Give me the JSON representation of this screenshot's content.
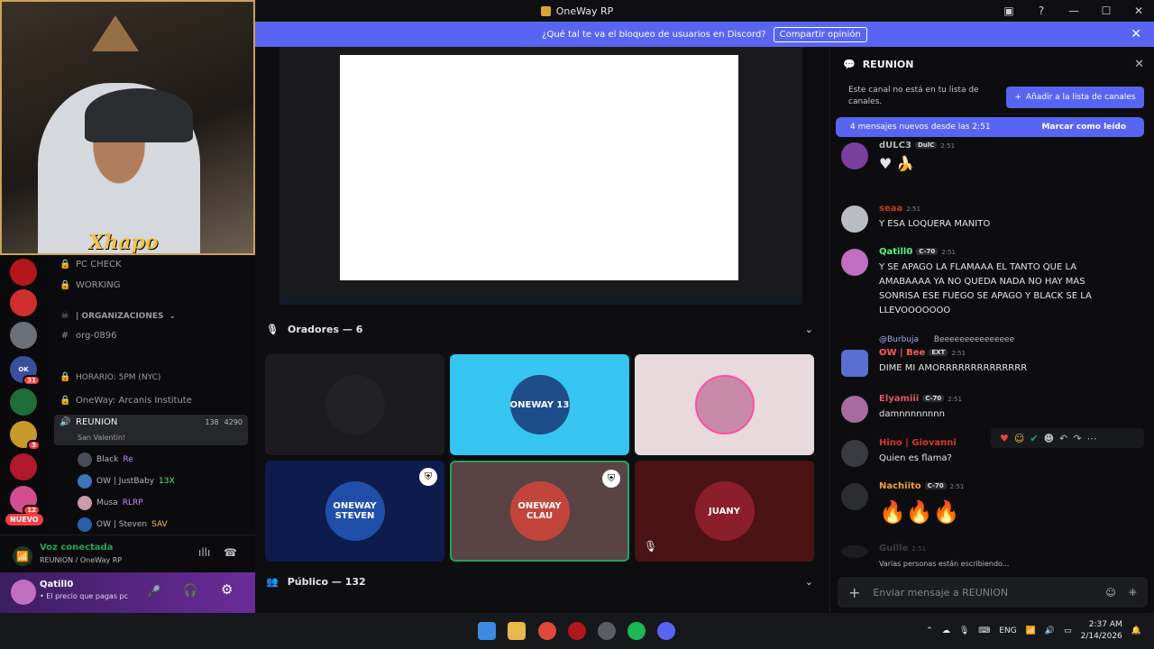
{
  "window": {
    "title": "OneWay RP"
  },
  "banner": {
    "text": "¿Qué tal te va el bloqueo de usuarios en Discord?",
    "button": "Compartir opinión"
  },
  "webcam": {
    "brand": "Xhapo"
  },
  "servers": [
    {
      "label": "",
      "color": "#b3161b",
      "badge": ""
    },
    {
      "label": "",
      "color": "#cf2e2e",
      "badge": ""
    },
    {
      "label": "",
      "color": "#6b6f78",
      "badge": ""
    },
    {
      "label": "OK",
      "color": "#3b4fa0",
      "badge": "31"
    },
    {
      "label": "",
      "color": "#1f6e3a",
      "badge": ""
    },
    {
      "label": "",
      "color": "#c79a2a",
      "badge": "3"
    },
    {
      "label": "",
      "color": "#b0182d",
      "badge": ""
    },
    {
      "label": "",
      "color": "#d24d8e",
      "badge": "12"
    }
  ],
  "nuevo": "NUEVO",
  "channels": {
    "pc_check": "PC CHECK",
    "working": "WORKING",
    "organizaciones": "| ORGANIZACIONES",
    "org": "org-0896",
    "horario": "HORARIO: 5PM (NYC)",
    "institute": "OneWay: Arcanis Institute",
    "voice_channel": "REUNION",
    "voice_sub": "San Valentin!",
    "voice_count_a": "138",
    "voice_count_b": "4290",
    "members": [
      {
        "name": "Black",
        "tag": "Re"
      },
      {
        "name": "OW | JustBaby",
        "tag": "13X"
      },
      {
        "name": "Musa",
        "tag": "RLRP"
      },
      {
        "name": "OW | Steven",
        "tag": "SAV"
      }
    ]
  },
  "voice_panel": {
    "status": "Voz conectada",
    "location": "REUNION / OneWay RP"
  },
  "user_panel": {
    "name": "Qatill0",
    "status": "• El precio que pagas pc"
  },
  "stage": {
    "speakers_label": "Oradores — 6",
    "public_label": "Público — 132",
    "tiles": [
      {
        "label": "",
        "bg": "#1c1c1e",
        "avatar": "#2a2a2c"
      },
      {
        "label": "ONEWAY 13",
        "bg": "#36c5f0",
        "avatar": "#1d4e8a"
      },
      {
        "label": "",
        "bg": "#e7d9dc",
        "avatar": "#c98aa8"
      },
      {
        "label": "ONEWAY STEVEN",
        "bg": "#0e1b4d",
        "avatar": "#1f4fa8"
      },
      {
        "label": "ONEWAY CLAU",
        "bg": "#5a4345",
        "avatar": "#c2453c"
      },
      {
        "label": "JUANY",
        "bg": "#4a1414",
        "avatar": "#8a1e2a"
      }
    ]
  },
  "chat": {
    "channel": "REUNION",
    "notice": "Este canal no está en tu lista de canales.",
    "add_button": "Añadir a la lista de canales",
    "new_messages": "4 mensajes nuevos desde las 2:51",
    "mark_read": "Marcar como leído",
    "messages": [
      {
        "name": "dULC3",
        "tag": "DulC",
        "time": "2:51",
        "text": "",
        "color": "#b5bac1",
        "avatar": "#7b3fa0"
      },
      {
        "name": "seaa",
        "tag": "",
        "time": "2:51",
        "text": "Y ESA LOQUERA MANITO",
        "color": "#c0392b",
        "avatar": "#b9bcc2"
      },
      {
        "name": "Qatill0",
        "tag": "C-70",
        "time": "2:51",
        "text": "Y SE APAGO LA FLAMAAA EL TANTO QUE LA AMABAAAA YA NO QUEDA NADA NO HAY MAS SONRISA ESE FUEGO SE APAGO Y BLACK SE LA LLEVOOOOOOO",
        "color": "#57f287",
        "avatar": "#c06fc0"
      },
      {
        "name": "OW | Bee",
        "tag": "EXT",
        "time": "2:51",
        "text": "DIME MI AMORRRRRRRRRRRRRR",
        "color": "#ff5a5a",
        "avatar": "#5a6fd0"
      },
      {
        "name": "Elyamiii",
        "tag": "C-70",
        "time": "2:51",
        "text": "damnnnnnnnn",
        "color": "#e0556b",
        "avatar": "#a86ba0"
      },
      {
        "name": "Hino | Giovanni",
        "tag": "",
        "time": "",
        "text": "Quien es flama?",
        "color": "#d9343a",
        "avatar": "#3a3b40"
      },
      {
        "name": "Nachiito",
        "tag": "C-70",
        "time": "2:51",
        "text": "🔥🔥🔥",
        "color": "#f0a03a",
        "avatar": "#2c2d31"
      },
      {
        "name": "Guille",
        "tag": "",
        "time": "2:51",
        "text": "",
        "color": "#6b6e75",
        "avatar": "#2c2d31"
      }
    ],
    "reply_snippet": "@Burbuja",
    "reply_text": "Beeeeeeeeeeeeeee",
    "typing": "Varias personas están escribiendo...",
    "input_placeholder": "Enviar mensaje a  REUNION"
  },
  "taskbar": {
    "lang": "ENG",
    "time": "2:37 AM",
    "date": "2/14/2026"
  }
}
